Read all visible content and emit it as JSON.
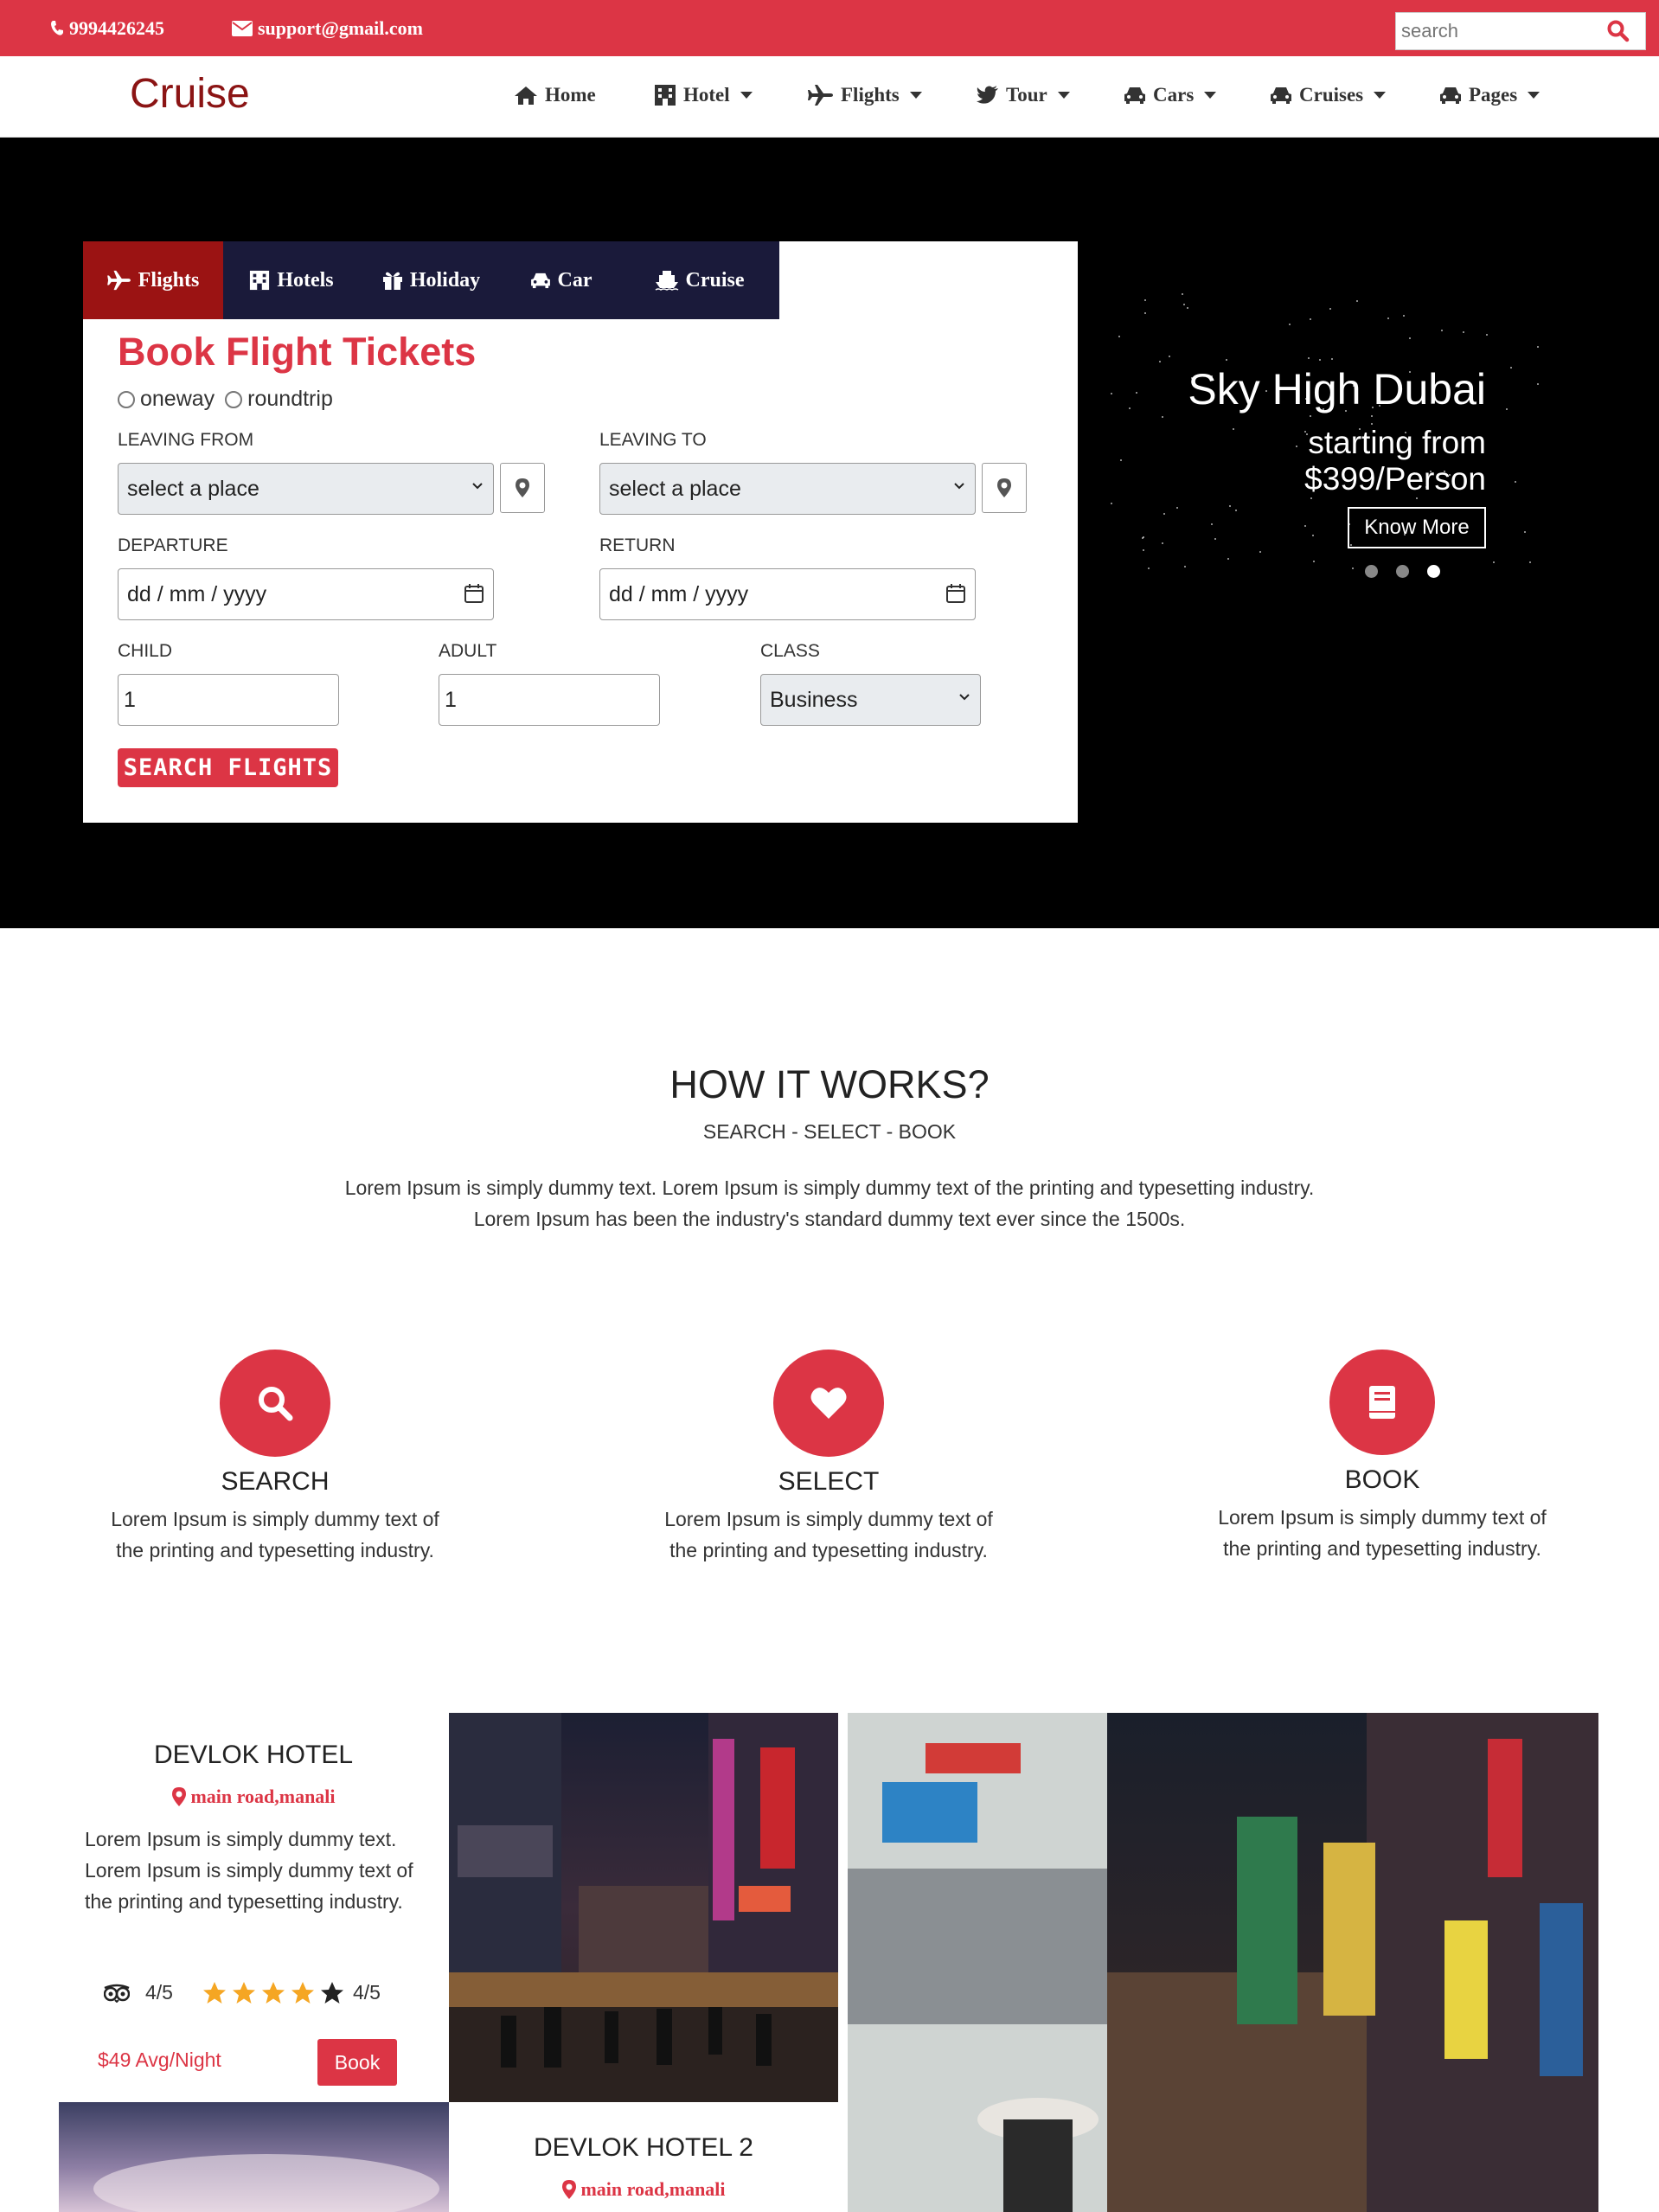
{
  "topbar": {
    "phone": "9994426245",
    "email": "support@gmail.com",
    "search_placeholder": "search"
  },
  "brand": "Cruise",
  "nav": {
    "items": [
      {
        "label": "Home",
        "icon": "home-icon"
      },
      {
        "label": "Hotel",
        "icon": "building-icon"
      },
      {
        "label": "Flights",
        "icon": "plane-icon"
      },
      {
        "label": "Tour",
        "icon": "bird-icon"
      },
      {
        "label": "Cars",
        "icon": "car-icon"
      },
      {
        "label": "Cruises",
        "icon": "car-icon"
      },
      {
        "label": "Pages",
        "icon": "car-icon"
      }
    ]
  },
  "booking": {
    "tabs": [
      {
        "label": "Flights",
        "icon": "plane-icon",
        "active": true
      },
      {
        "label": "Hotels",
        "icon": "building-icon",
        "active": false
      },
      {
        "label": "Holiday",
        "icon": "gift-icon",
        "active": false
      },
      {
        "label": "Car",
        "icon": "car-icon",
        "active": false
      },
      {
        "label": "Cruise",
        "icon": "ship-icon",
        "active": false
      }
    ],
    "title": "Book Flight Tickets",
    "trip_options": [
      "oneway",
      "roundtrip"
    ],
    "leaving_from_label": "LEAVING FROM",
    "leaving_from_value": "select a place",
    "leaving_to_label": "LEAVING TO",
    "leaving_to_value": "select a place",
    "departure_label": "DEPARTURE",
    "departure_value": "dd / mm / yyyy",
    "return_label": "RETURN",
    "return_value": "dd / mm / yyyy",
    "child_label": "CHILD",
    "child_value": "1",
    "adult_label": "ADULT",
    "adult_value": "1",
    "class_label": "CLASS",
    "class_value": "Business",
    "search_button": "SEARCH FLIGHTS"
  },
  "slide": {
    "title": "Sky High Dubai",
    "line1": "starting from",
    "line2": "$399/Person",
    "button": "Know More",
    "active_dot": 3,
    "total_dots": 3
  },
  "how_it_works": {
    "title": "HOW IT WORKS?",
    "subtitle": "SEARCH - SELECT - BOOK",
    "desc_line1": "Lorem Ipsum is simply dummy text. Lorem Ipsum is simply dummy text of the printing and typesetting industry.",
    "desc_line2": "Lorem Ipsum has been the industry's standard dummy text ever since the 1500s.",
    "steps": [
      {
        "title": "SEARCH",
        "icon": "search-icon",
        "line1": "Lorem Ipsum is simply dummy text of",
        "line2": "the printing and typesetting industry."
      },
      {
        "title": "SELECT",
        "icon": "heart-icon",
        "line1": "Lorem Ipsum is simply dummy text of",
        "line2": "the printing and typesetting industry."
      },
      {
        "title": "BOOK",
        "icon": "book-icon",
        "line1": "Lorem Ipsum is simply dummy text of",
        "line2": "the printing and typesetting industry."
      }
    ]
  },
  "hotels": [
    {
      "name": "DEVLOK HOTEL",
      "location": "main road,manali",
      "desc": "Lorem Ipsum is simply dummy text. Lorem Ipsum is simply dummy text of the printing and typesetting industry.",
      "tripadvisor_rating": "4/5",
      "star_rating": "4/5",
      "stars": 4,
      "price": "$49 Avg/Night",
      "book_label": "Book"
    },
    {
      "name": "DEVLOK HOTEL 2",
      "location": "main road,manali"
    }
  ],
  "colors": {
    "accent": "#dc3545",
    "brand": "#8b1414",
    "tab_bar": "#1a1a3a",
    "tab_active": "#9b1313"
  }
}
